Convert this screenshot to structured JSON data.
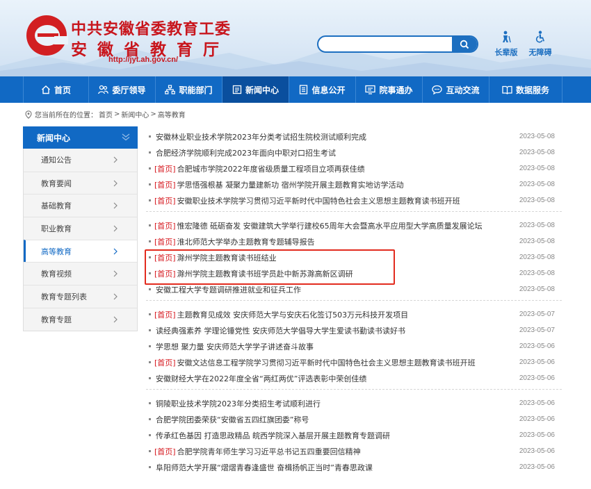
{
  "header": {
    "org_line1": "中共安徽省委教育工委",
    "org_line2": "安徽省教育厅",
    "url": "http://jyt.ah.gov.cn/",
    "search_placeholder": "",
    "tools": [
      {
        "label": "长辈版",
        "icon": "elder-icon"
      },
      {
        "label": "无障碍",
        "icon": "accessibility-icon"
      }
    ]
  },
  "nav": {
    "items": [
      {
        "label": "首页",
        "icon": "home-icon"
      },
      {
        "label": "委厅领导",
        "icon": "leaders-icon"
      },
      {
        "label": "职能部门",
        "icon": "departments-icon"
      },
      {
        "label": "新闻中心",
        "icon": "news-icon"
      },
      {
        "label": "信息公开",
        "icon": "info-icon"
      },
      {
        "label": "院事通办",
        "icon": "service-icon"
      },
      {
        "label": "互动交流",
        "icon": "chat-icon"
      },
      {
        "label": "数据服务",
        "icon": "data-icon"
      }
    ]
  },
  "breadcrumb": {
    "prefix": "您当前所在的位置：",
    "items": [
      "首页",
      "新闻中心",
      "高等教育"
    ],
    "sep": ">"
  },
  "sidebar": {
    "title": "新闻中心",
    "items": [
      {
        "label": "通知公告"
      },
      {
        "label": "教育要闻"
      },
      {
        "label": "基础教育"
      },
      {
        "label": "职业教育"
      },
      {
        "label": "高等教育"
      },
      {
        "label": "教育视频"
      },
      {
        "label": "教育专题列表"
      },
      {
        "label": "教育专题"
      }
    ]
  },
  "news": {
    "groups": [
      [
        {
          "tag": "",
          "title": "安徽林业职业技术学院2023年分类考试招生院校测试顺利完成",
          "date": "2023-05-08"
        },
        {
          "tag": "",
          "title": "合肥经济学院顺利完成2023年面向中职对口招生考试",
          "date": "2023-05-08"
        },
        {
          "tag": "[首页]",
          "title": "合肥城市学院2022年度省级质量工程项目立项再获佳绩",
          "date": "2023-05-08"
        },
        {
          "tag": "[首页]",
          "title": "学思悟强根基 凝聚力量建新功 宿州学院开展主题教育实地访学活动",
          "date": "2023-05-08"
        },
        {
          "tag": "[首页]",
          "title": "安徽职业技术学院学习贯彻习近平新时代中国特色社会主义思想主题教育读书班开班",
          "date": "2023-05-08"
        }
      ],
      [
        {
          "tag": "[首页]",
          "title": "惟宏隆德 砥砺奋发 安徽建筑大学举行建校65周年大会暨高水平应用型大学高质量发展论坛",
          "date": "2023-05-08"
        },
        {
          "tag": "[首页]",
          "title": "淮北师范大学举办主题教育专题辅导报告",
          "date": "2023-05-08"
        },
        {
          "tag": "[首页]",
          "title": "滁州学院主题教育读书班结业",
          "date": "2023-05-08"
        },
        {
          "tag": "[首页]",
          "title": "滁州学院主题教育读书班学员赴中新苏滁高新区调研",
          "date": "2023-05-08"
        },
        {
          "tag": "",
          "title": "安徽工程大学专题调研推进就业和征兵工作",
          "date": "2023-05-08"
        }
      ],
      [
        {
          "tag": "[首页]",
          "title": "主题教育见成效 安庆师范大学与安庆石化签订503万元科技开发项目",
          "date": "2023-05-07"
        },
        {
          "tag": "",
          "title": "读经典强素养 学理论锤党性 安庆师范大学倡导大学生爱读书勤读书读好书",
          "date": "2023-05-07"
        },
        {
          "tag": "",
          "title": "学思想 聚力量 安庆师范大学学子讲述奋斗故事",
          "date": "2023-05-06"
        },
        {
          "tag": "[首页]",
          "title": "安徽文达信息工程学院学习贯彻习近平新时代中国特色社会主义思想主题教育读书班开班",
          "date": "2023-05-06"
        },
        {
          "tag": "",
          "title": "安徽财经大学在2022年度全省“两红两优”评选表彰中荣创佳绩",
          "date": "2023-05-06"
        }
      ],
      [
        {
          "tag": "",
          "title": "铜陵职业技术学院2023年分类招生考试顺利进行",
          "date": "2023-05-06"
        },
        {
          "tag": "",
          "title": "合肥学院团委荣获“安徽省五四红旗团委”称号",
          "date": "2023-05-06"
        },
        {
          "tag": "",
          "title": "传承红色基因 打造思政精品 皖西学院深入基层开展主题教育专题调研",
          "date": "2023-05-06"
        },
        {
          "tag": "[首页]",
          "title": "合肥学院青年师生学习习近平总书记五四重要回信精神",
          "date": "2023-05-06"
        },
        {
          "tag": "",
          "title": "阜阳师范大学开展“熠熠青春逢盛世 奋楫扬帆正当时”青春思政课",
          "date": "2023-05-06"
        }
      ]
    ]
  },
  "colors": {
    "primary": "#1169c4",
    "active": "#0a4f9e",
    "brand_red": "#c8161d",
    "highlight": "#e22b1e"
  }
}
